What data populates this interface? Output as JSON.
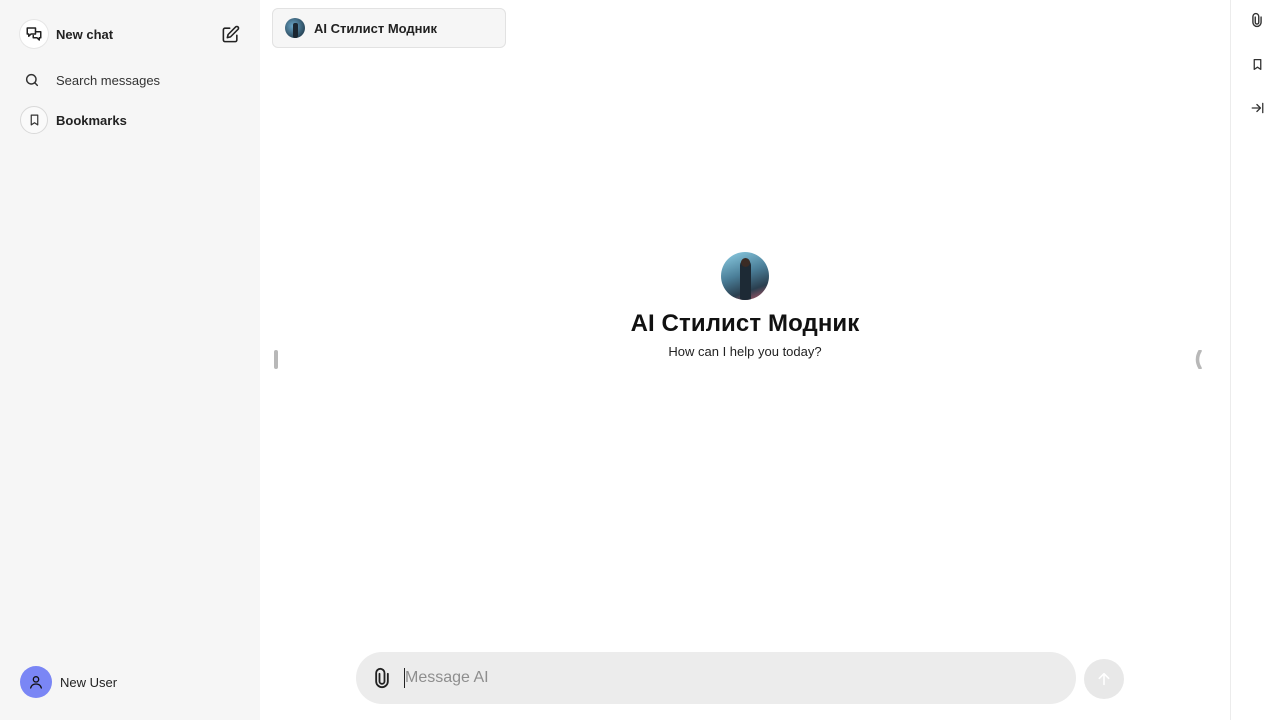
{
  "sidebar": {
    "new_chat_label": "New chat",
    "search_label": "Search messages",
    "bookmarks_label": "Bookmarks",
    "user_name": "New User"
  },
  "header": {
    "model_name": "AI Стилист Модник"
  },
  "main": {
    "assistant_title": "AI Стилист Модник",
    "assistant_subtitle": "How can I help you today?"
  },
  "composer": {
    "placeholder": "Message AI",
    "value": ""
  },
  "icons": {
    "new_chat": "chat-bubbles-icon",
    "edit": "edit-icon",
    "search": "search-icon",
    "bookmark": "bookmark-icon",
    "user": "user-icon",
    "attach": "paperclip-icon",
    "send": "arrow-up-icon",
    "rail_attach": "paperclip-icon",
    "rail_bookmark": "bookmark-icon",
    "rail_collapse": "collapse-right-icon"
  },
  "colors": {
    "sidebar_bg": "#f6f6f6",
    "avatar_bg": "#7a86f5",
    "composer_bg": "#ececec"
  }
}
